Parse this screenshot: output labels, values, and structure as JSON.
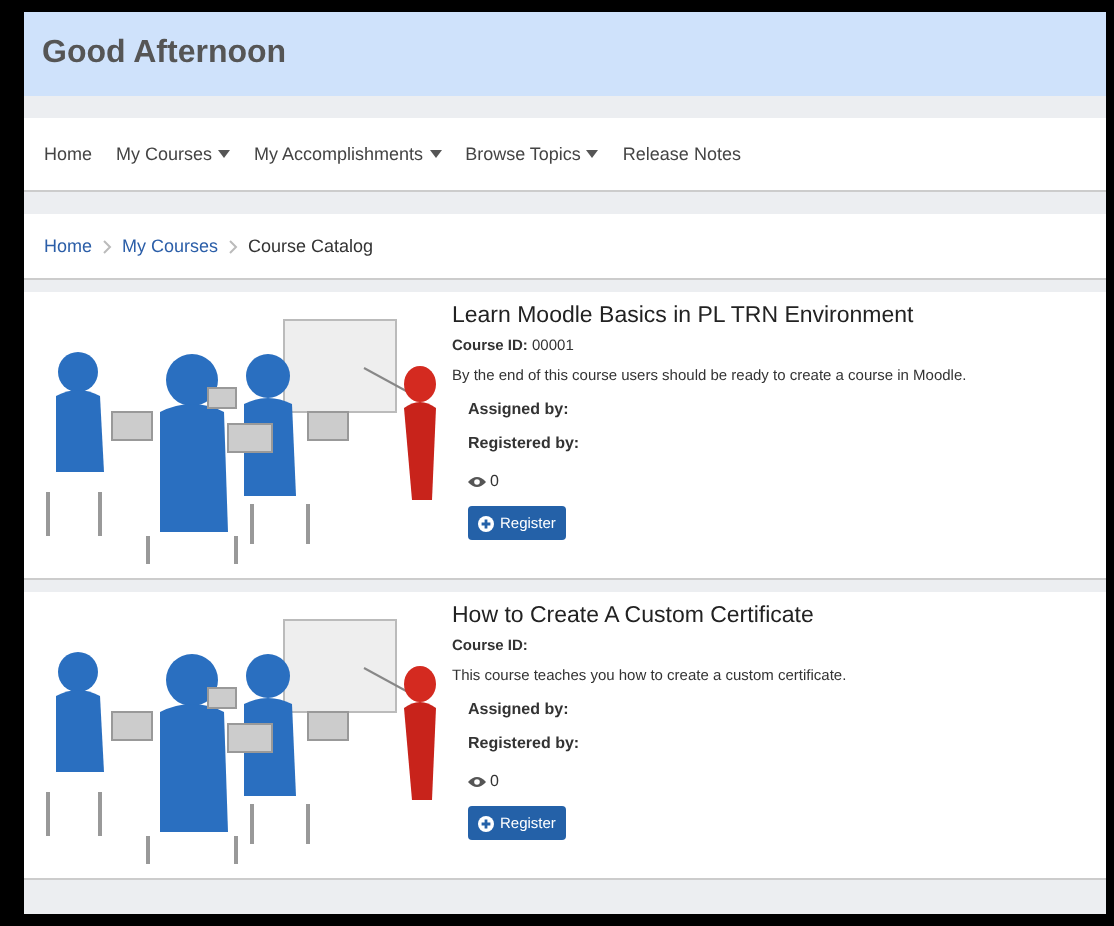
{
  "header": {
    "greeting": "Good Afternoon"
  },
  "nav": [
    {
      "label": "Home",
      "dropdown": false
    },
    {
      "label": "My Courses",
      "dropdown": true
    },
    {
      "label": "My Accomplishments",
      "dropdown": true
    },
    {
      "label": "Browse Topics",
      "dropdown": true
    },
    {
      "label": "Release Notes",
      "dropdown": false
    }
  ],
  "breadcrumb": [
    {
      "label": "Home",
      "link": true
    },
    {
      "label": "My Courses",
      "link": true
    },
    {
      "label": "Course Catalog",
      "link": false
    }
  ],
  "courses": [
    {
      "title": "Learn Moodle Basics in PL TRN Environment",
      "course_id_label": "Course ID:",
      "course_id": "00001",
      "description": "By the end of this course users should be ready to create a course in Moodle.",
      "assigned_label": "Assigned by:",
      "registered_label": "Registered by:",
      "views": "0",
      "button": "Register"
    },
    {
      "title": "How to Create A Custom Certificate",
      "course_id_label": "Course ID:",
      "description": "This course teaches you how to create a custom certificate.",
      "assigned_label": "Assigned by:",
      "registered_label": "Registered by:",
      "views": "0",
      "button": "Register"
    }
  ]
}
